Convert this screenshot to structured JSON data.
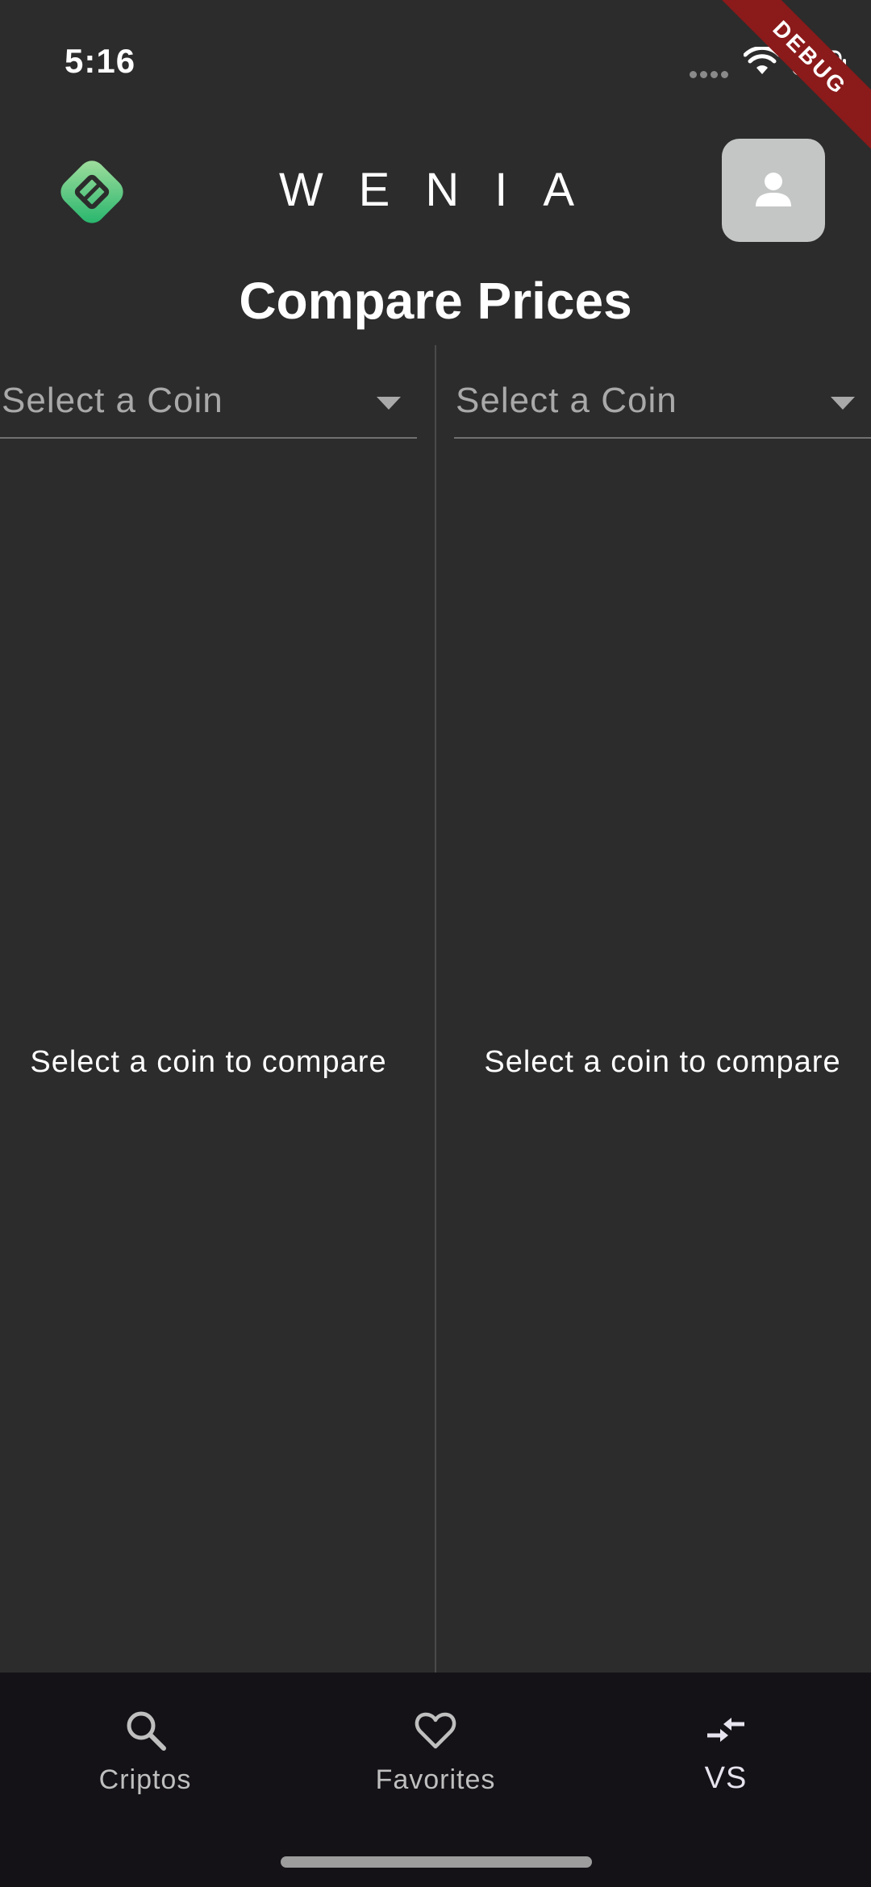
{
  "status_bar": {
    "time": "5:16",
    "icons": [
      "signal-dots-icon",
      "wifi-icon",
      "battery-icon"
    ],
    "debug_banner": "DEBUG"
  },
  "header": {
    "logo_icon": "wenia-logo-icon",
    "brand": "WENIA",
    "profile_icon": "person-icon"
  },
  "page": {
    "title": "Compare Prices"
  },
  "compare": {
    "left": {
      "placeholder": "Select a Coin",
      "empty_message": "Select a coin to compare"
    },
    "right": {
      "placeholder": "Select a Coin",
      "empty_message": "Select a coin to compare"
    }
  },
  "bottom_nav": {
    "items": [
      {
        "label": "Criptos",
        "icon": "search-icon",
        "active": false
      },
      {
        "label": "Favorites",
        "icon": "heart-icon",
        "active": false
      },
      {
        "label": "VS",
        "icon": "compare-arrows-icon",
        "active": true
      }
    ]
  },
  "colors": {
    "background": "#2c2c2c",
    "nav_background": "#141217",
    "logo_green": "#2fbf71",
    "profile_button": "#c4c6c5",
    "debug_red": "#8b1a1a"
  }
}
